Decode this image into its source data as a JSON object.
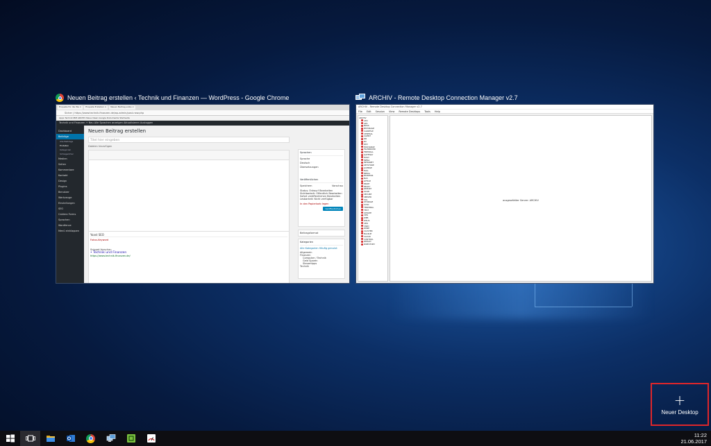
{
  "windows": {
    "chrome": {
      "title": "Neuen Beitrag erstellen ‹ Technik und Finanzen — WordPress - Google Chrome",
      "icon": "chrome-icon",
      "tabs": [
        "Enquete für die Wa ×",
        "Enquete Erstellen ×",
        "Neuen Beitrag erste ×"
      ],
      "address": "Sicher | https://www.technik-finanzen.de/wp-admin/post-new.php",
      "bookmarks": "Apps  Technik  IBM  ARCHIV  Neue Ideen  Google  Dokumente  Startseite",
      "adminbar": "Technik und Finanzen   +  Neu   Alle Sprachen anzeigen   Aktualisieren   Ausloggen",
      "sidebar": {
        "items": [
          "Dashboard",
          "Beiträge",
          "Medien",
          "Seiten",
          "Kommentare",
          "Kontakt",
          "Design",
          "Plugins",
          "Benutzer",
          "Werkzeuge",
          "Einstellungen",
          "SEO",
          "Caldera Forms",
          "Sprachen",
          "Wordfence",
          "Menü einklappen"
        ],
        "subitems": [
          "Alle Beiträge",
          "Erstellen",
          "Kategorien",
          "Schlagwörter"
        ],
        "active_index": 1
      },
      "page_title": "Neuen Beitrag erstellen",
      "title_placeholder": "Titel hier eingeben",
      "add_media": "Dateien hinzufügen",
      "word_count": "Wortanzahl: 0",
      "panels": {
        "languages": "Sprachen",
        "language_label": "Sprache",
        "language_value": "Deutsch",
        "translations": "Übersetzungen",
        "publish": "Veröffentlichen",
        "save_draft": "Speichern",
        "preview": "Vorschau",
        "status": "Status: Entwurf  Bearbeiten",
        "visibility": "Sichtbarkeit: Öffentlich  Bearbeiten",
        "immediately": "Sofort veröffentlichen  Bearbeiten",
        "seo_score": "Lesbarkeit: Nicht verfügbar",
        "trash": "In den Papierkorb legen",
        "publish_button": "Veröffentlichen",
        "post_format": "Beitragsformat",
        "categories": "Kategorien",
        "all_categories": "Alle Kategorien   Häufig genutzt",
        "category_items": [
          "Allgemein",
          "Finanzen",
          "Computer / Technik",
          "Geld Sparen",
          "Steuertipps",
          "Technik"
        ]
      },
      "seo_box": {
        "title": "Yoast SEO",
        "keyword_label": "Fokus-Keyword",
        "snippet_title": "Snippet-Vorschau",
        "snippet_text": "• Technik und Finanzen",
        "snippet_url": "https://www.technik-finanzen.de/"
      }
    },
    "rdcman": {
      "title": "ARCHIV - Remote Desktop Connection Manager v2.7",
      "icon": "rdcman-icon",
      "inner_title": "ARCHIV - Remote Desktop Connection Manager v2.7",
      "menu": [
        "File",
        "Edit",
        "Session",
        "View",
        "Remote Desktops",
        "Tools",
        "Help"
      ],
      "root": "ARCHIV",
      "servers": [
        "ADC",
        "APC",
        "BOSS",
        "BSTORAGE",
        "CARDFILE",
        "CENTRAL",
        "CLIENT",
        "DB",
        "DC",
        "DEV",
        "EXCHANGE",
        "FILESERVER",
        "FIREWALL",
        "GATEWAY",
        "HOST",
        "INFRA",
        "INTRANET",
        "KEYSTORE",
        "LICENSE",
        "MAIL",
        "MEDIA",
        "MONITOR",
        "NAS",
        "OFFICE",
        "PRINT",
        "PROXY",
        "REPORT",
        "SCAN",
        "SECURE",
        "SERVER",
        "SQL",
        "STORAGE",
        "SYNC",
        "TERMINAL",
        "TEST",
        "UPDATE",
        "VPN",
        "WEB",
        "WSUS",
        "XEN",
        "YARD",
        "ZONE",
        "CLUSTER",
        "BACKUP",
        "CLOUD",
        "CONTROL",
        "DEPLOY",
        "DIRECTORY"
      ],
      "main_text": "ausgewählter Server: ARCHIV"
    }
  },
  "new_desktop": {
    "plus": "+",
    "label": "Neuer Desktop"
  },
  "taskbar": {
    "apps": [
      "windows-start",
      "task-view",
      "file-explorer",
      "outlook",
      "chrome",
      "rdcman",
      "onenote",
      "speedometer"
    ],
    "time": "11:22",
    "date": "21.06.2017"
  }
}
